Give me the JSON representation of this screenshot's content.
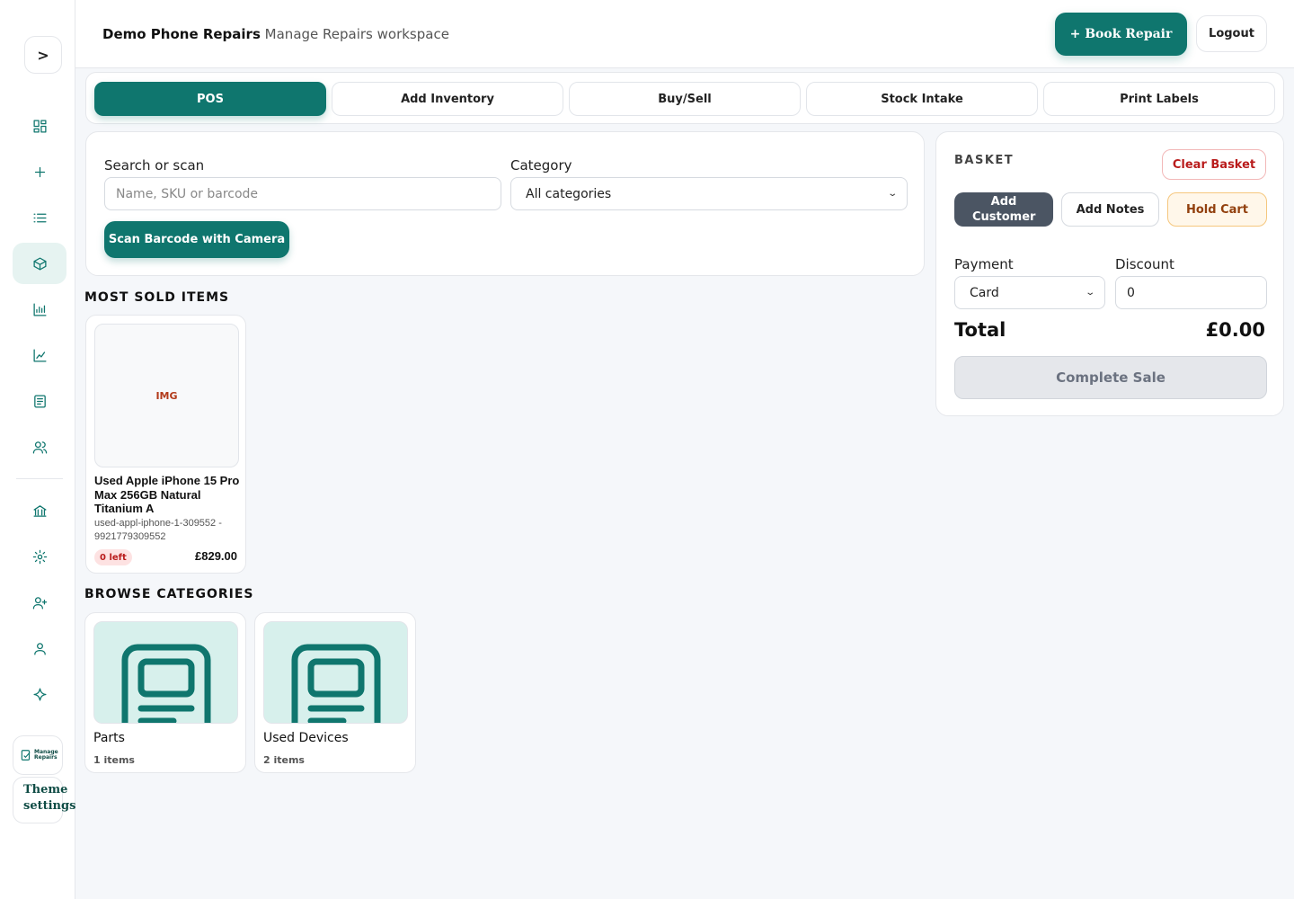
{
  "sidebar": {
    "toggle_label": ">",
    "logo_text": "Manage Repairs",
    "theme_label": "Theme settings"
  },
  "header": {
    "business_name": "Demo Phone Repairs",
    "workspace": "Manage Repairs workspace",
    "book_repair": "+ Book Repair",
    "logout": "Logout"
  },
  "tabs": [
    "POS",
    "Add Inventory",
    "Buy/Sell",
    "Stock Intake",
    "Print Labels"
  ],
  "search": {
    "label": "Search or scan",
    "placeholder": "Name, SKU or barcode",
    "category_label": "Category",
    "category_value": "All categories",
    "scan_button": "Scan Barcode with Camera"
  },
  "most_sold": {
    "title": "MOST SOLD ITEMS",
    "items": [
      {
        "image_placeholder": "IMG",
        "name": "Used Apple iPhone 15 Pro Max 256GB Natural Titanium A",
        "sku": "used-appl-iphone-1-309552 - 9921779309552",
        "stock": "0 left",
        "price": "£829.00"
      }
    ]
  },
  "categories": {
    "title": "BROWSE CATEGORIES",
    "items": [
      {
        "name": "Parts",
        "count": "1 items"
      },
      {
        "name": "Used Devices",
        "count": "2 items"
      }
    ]
  },
  "basket": {
    "title": "BASKET",
    "clear": "Clear Basket",
    "add_customer": "Add Customer",
    "add_notes": "Add Notes",
    "hold_cart": "Hold Cart",
    "payment_label": "Payment",
    "payment_value": "Card",
    "discount_label": "Discount",
    "discount_value": "0",
    "total_label": "Total",
    "total_value": "£0.00",
    "complete": "Complete Sale"
  },
  "colors": {
    "accent": "#0f766e",
    "danger": "#b91c1c",
    "warning": "#92400e",
    "neutral_dark": "#4b5563"
  }
}
